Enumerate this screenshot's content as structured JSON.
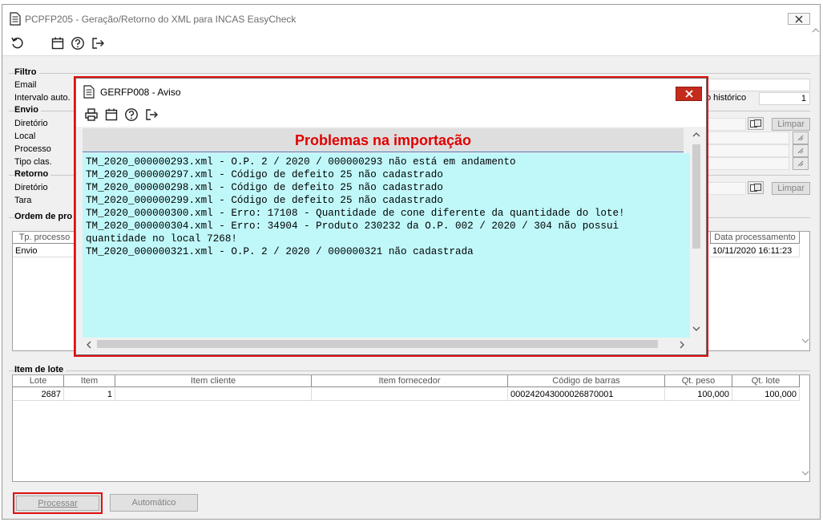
{
  "window": {
    "title": "PCPFP205 - Geração/Retorno do XML para INCAS EasyCheck"
  },
  "filtro": {
    "legend": "Filtro",
    "email_label": "Email",
    "intervalo_label": "Intervalo auto.",
    "historico_label": "o histórico",
    "historico_value": "1"
  },
  "envio": {
    "legend": "Envio",
    "diretorio_label": "Diretório",
    "local_label": "Local",
    "processo_label": "Processo",
    "tipo_clas_label": "Tipo clas.",
    "limpar_label": "Limpar"
  },
  "retorno": {
    "legend": "Retorno",
    "diretorio_label": "Diretório",
    "tara_label": "Tara",
    "limpar_label": "Limpar"
  },
  "ordem": {
    "legend": "Ordem de pro",
    "col_tp_processo": "Tp. processo",
    "col_data_processamento": "Data processamento",
    "row_tp_processo": "Envio",
    "row_data_processamento": "10/11/2020 16:11:23"
  },
  "item_lote": {
    "legend": "Item de lote",
    "columns": [
      "Lote",
      "Item",
      "Item cliente",
      "Item fornecedor",
      "Código de barras",
      "Qt. peso",
      "Qt. lote"
    ],
    "rows": [
      {
        "lote": "2687",
        "item": "1",
        "item_cliente": "",
        "item_fornecedor": "",
        "codigo_barras": "000242043000026870001",
        "qt_peso": "100,000",
        "qt_lote": "100,000"
      }
    ]
  },
  "buttons": {
    "processar": "Processar",
    "automatico": "Automático"
  },
  "dialog": {
    "title": "GERFP008 - Aviso",
    "banner": "Problemas na importação",
    "lines": [
      "TM_2020_000000293.xml - O.P. 2 / 2020 / 000000293 não está em andamento",
      "TM_2020_000000297.xml - Código de defeito 25 não cadastrado",
      "TM_2020_000000298.xml - Código de defeito 25 não cadastrado",
      "TM_2020_000000299.xml - Código de defeito 25 não cadastrado",
      "TM_2020_000000300.xml - Erro: 17108 - Quantidade de cone diferente da quantidade do lote!",
      "TM_2020_000000304.xml - Erro: 34904 - Produto 230232 da O.P. 002 / 2020 / 304 não possui",
      "quantidade no local 7268!",
      "TM_2020_000000321.xml - O.P. 2 / 2020 / 000000321 não cadastrada"
    ]
  },
  "colors": {
    "dialog_border": "#e01010",
    "banner_text": "#e00000",
    "log_background": "#c0f8fa",
    "close_button": "#c42b1c"
  },
  "icons": [
    "document-icon",
    "refresh-icon",
    "calendar-icon",
    "help-icon",
    "exit-icon",
    "print-icon",
    "close-icon",
    "folder-icon",
    "lookup-icon",
    "scroll-up-icon",
    "scroll-down-icon",
    "scroll-left-icon",
    "scroll-right-icon"
  ]
}
